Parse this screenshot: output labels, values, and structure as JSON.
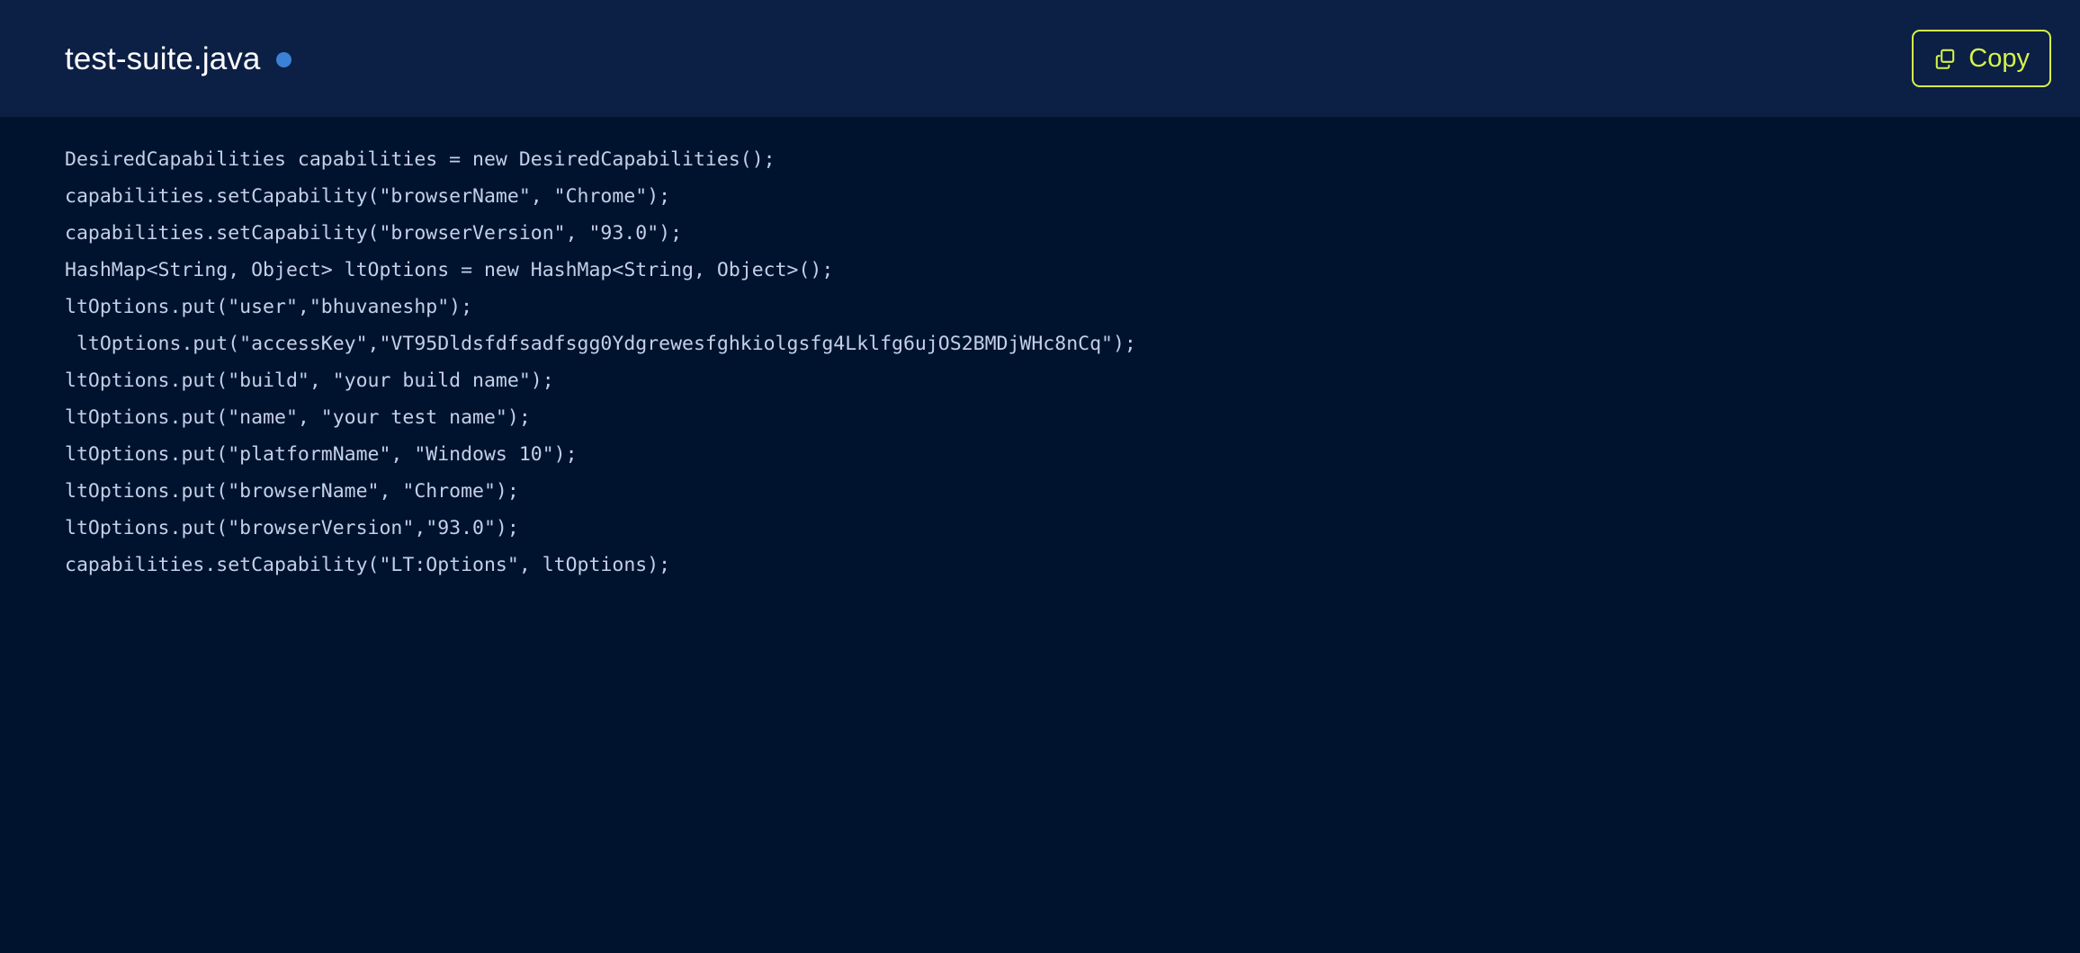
{
  "header": {
    "file_title": "test-suite.java",
    "status_dot": {
      "icon": "status-dot-icon",
      "color": "#3b82d6"
    },
    "copy_button": {
      "label": "Copy",
      "icon": "copy-icon",
      "accent_color": "#d4f34a"
    },
    "background_color": "#0c1f44"
  },
  "code": {
    "language": "java",
    "background_color": "#00132e",
    "text_color": "#c3d0e8",
    "lines": [
      "DesiredCapabilities capabilities = new DesiredCapabilities();",
      "capabilities.setCapability(\"browserName\", \"Chrome\");",
      "capabilities.setCapability(\"browserVersion\", \"93.0\");",
      "HashMap<String, Object> ltOptions = new HashMap<String, Object>();",
      "ltOptions.put(\"user\",\"bhuvaneshp\");",
      " ltOptions.put(\"accessKey\",\"VT95Dldsfdfsadfsgg0Ydgrewesfghkiolgsfg4Lklfg6ujOS2BMDjWHc8nCq\");",
      "ltOptions.put(\"build\", \"your build name\");",
      "ltOptions.put(\"name\", \"your test name\");",
      "ltOptions.put(\"platformName\", \"Windows 10\");",
      "ltOptions.put(\"browserName\", \"Chrome\");",
      "ltOptions.put(\"browserVersion\",\"93.0\");",
      "capabilities.setCapability(\"LT:Options\", ltOptions);"
    ]
  }
}
